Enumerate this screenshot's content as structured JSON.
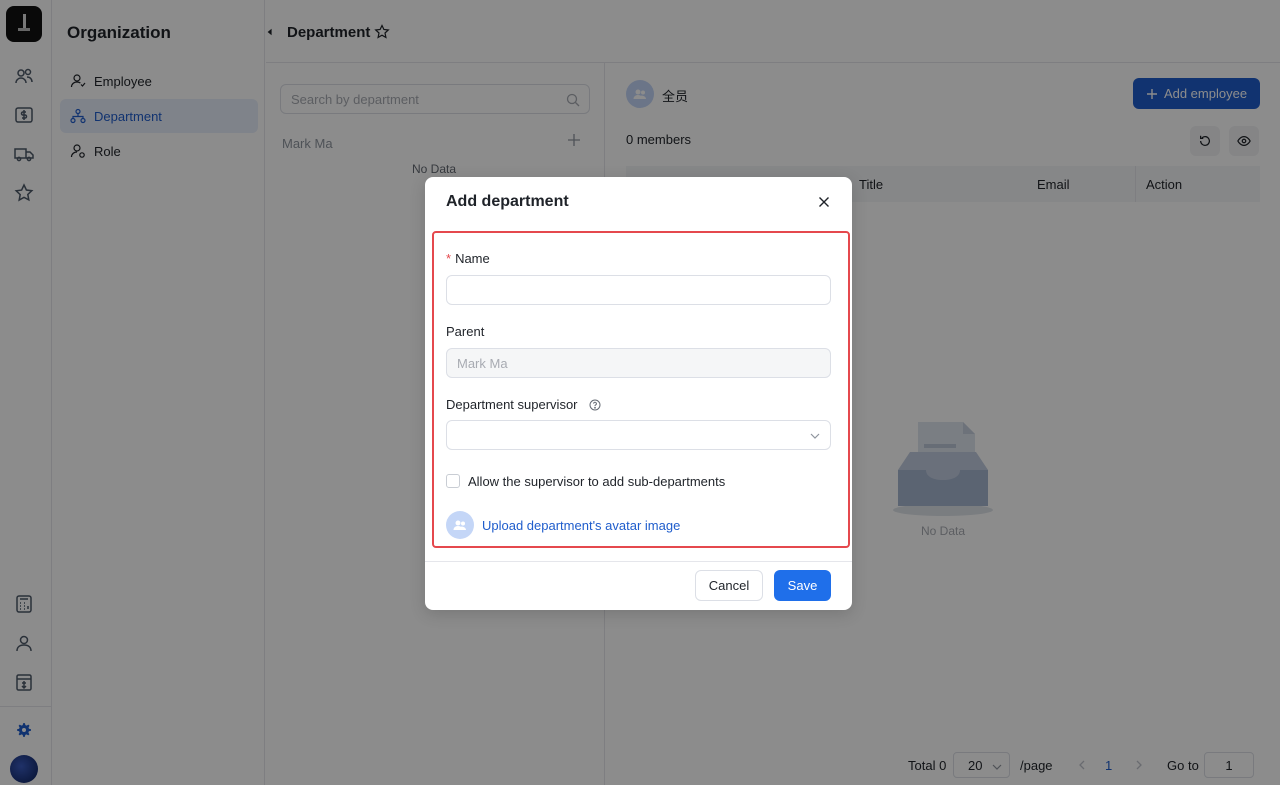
{
  "org_sidebar": {
    "title": "Organization",
    "items": [
      {
        "label": "Employee",
        "icon": "user-icon"
      },
      {
        "label": "Department",
        "icon": "org-tree-icon",
        "active": true
      },
      {
        "label": "Role",
        "icon": "role-icon"
      }
    ]
  },
  "header": {
    "title": "Department"
  },
  "dept_panel": {
    "search_placeholder": "Search by department",
    "root": "Mark Ma",
    "empty": "No Data"
  },
  "main": {
    "group_name": "全员",
    "add_button": "Add employee",
    "members": "0 members",
    "columns": {
      "title": "Title",
      "email": "Email",
      "action": "Action"
    },
    "empty": "No Data"
  },
  "pager": {
    "total": "Total 0",
    "page_size": "20",
    "per_page": "/page",
    "current": "1",
    "goto": "Go to",
    "goto_value": "1"
  },
  "modal": {
    "title": "Add department",
    "required_mark": "*",
    "name_label": "Name",
    "name_value": "",
    "parent_label": "Parent",
    "parent_value": "Mark Ma",
    "supervisor_label": "Department supervisor",
    "supervisor_value": "",
    "allow_label": "Allow the supervisor to add sub-departments",
    "upload_label": "Upload department's avatar image",
    "cancel": "Cancel",
    "save": "Save"
  },
  "colors": {
    "accent": "#1f5dcc",
    "save_button": "#1f6fea",
    "highlight": "#e5484d"
  }
}
